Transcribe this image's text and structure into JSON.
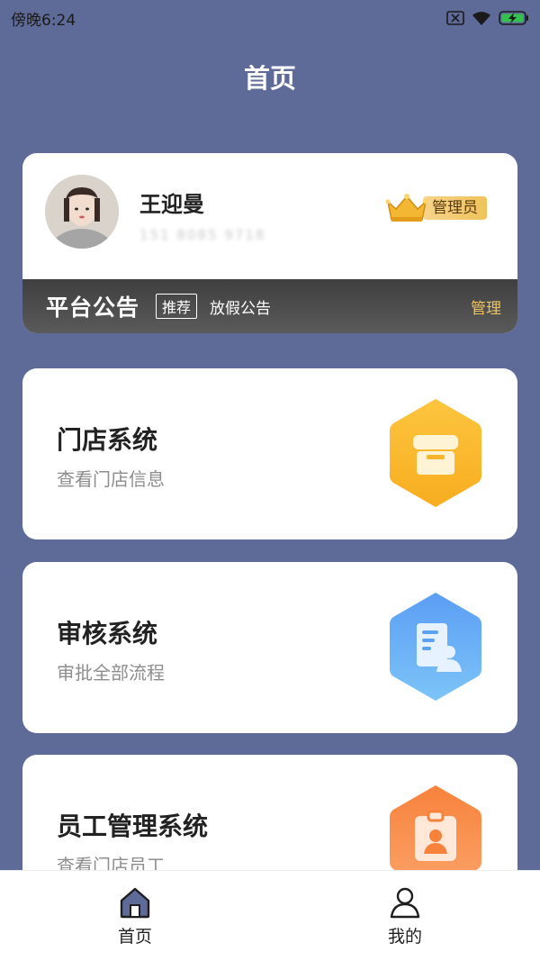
{
  "status_bar": {
    "time": "傍晚6:24"
  },
  "header": {
    "title": "首页"
  },
  "profile": {
    "name": "王迎曼",
    "phone": "151 8085 9718",
    "role_badge": "管理员"
  },
  "notice": {
    "title": "平台公告",
    "tag": "推荐",
    "text": "放假公告",
    "manage_label": "管理"
  },
  "systems": [
    {
      "title": "门店系统",
      "subtitle": "查看门店信息",
      "icon": "store-icon",
      "color": "#fbb92e"
    },
    {
      "title": "审核系统",
      "subtitle": "审批全部流程",
      "icon": "document-user-icon",
      "color": "#5aa7f5"
    },
    {
      "title": "员工管理系统",
      "subtitle": "查看门店员工",
      "icon": "staff-badge-icon",
      "color": "#f7823c"
    }
  ],
  "nav": {
    "home_label": "首页",
    "mine_label": "我的"
  },
  "colors": {
    "background": "#5e6b99",
    "accent_gold": "#f3c35a",
    "nav_active": "#5e6b99"
  }
}
